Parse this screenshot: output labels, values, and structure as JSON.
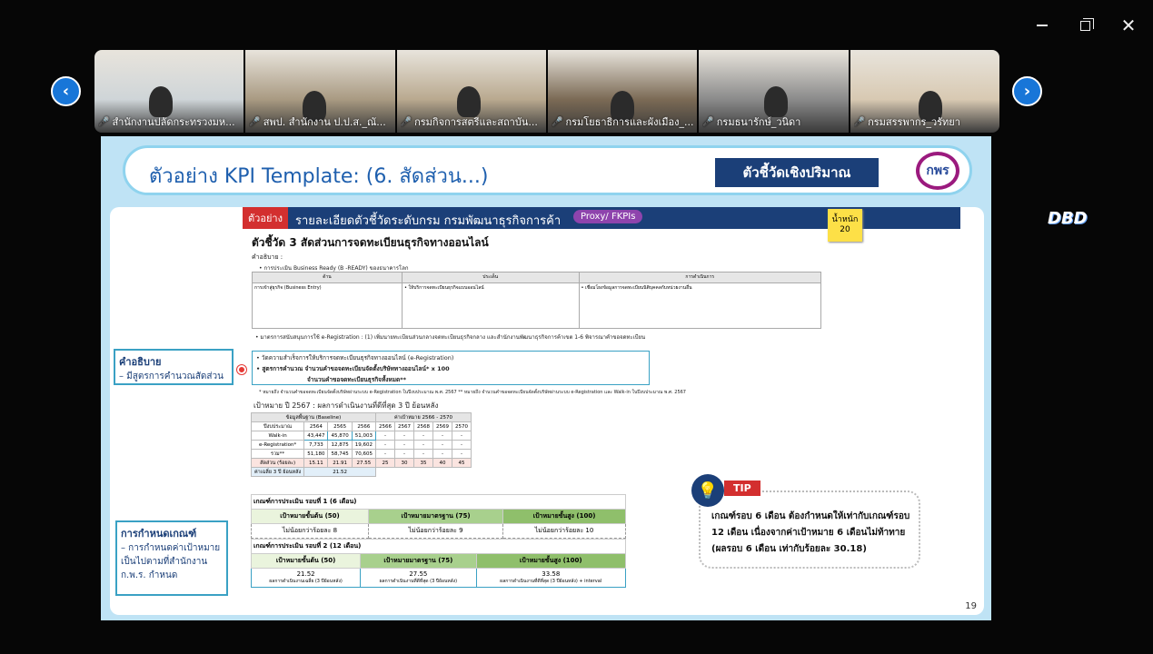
{
  "window": {
    "controls": [
      "minimize",
      "restore",
      "close"
    ]
  },
  "participants": [
    {
      "name": "สำนักงานปลัดกระทรวงมห...",
      "bg": "#cfd5d8"
    },
    {
      "name": "สพป. สำนักงาน ป.ป.ส._ณั...",
      "bg": "#a99a82"
    },
    {
      "name": "กรมกิจการสตรีและสถาบัน...",
      "bg": "#b9a98f"
    },
    {
      "name": "กรมโยธาธิการและผังเมือง_...",
      "bg": "#7b6a55"
    },
    {
      "name": "กรมธนารักษ์_วนิดา",
      "bg": "#8a8a8a"
    },
    {
      "name": "กรมสรรพากร_วรัทยา",
      "bg": "#d8c9b2"
    }
  ],
  "slide": {
    "title": "ตัวอย่าง KPI Template: (6. สัดส่วน...)",
    "badge": "ตัวชี้วัดเชิงปริมาณ",
    "logo": "กพร",
    "page": "19",
    "header": {
      "tag": "ตัวอย่าง",
      "title": "รายละเอียดตัวชี้วัดระดับกรม กรมพัฒนาธุรกิจการค้า",
      "proxy": "Proxy/ FKPIs",
      "logo": "DBD"
    },
    "weight": {
      "label": "น้ำหนัก",
      "value": "20"
    },
    "kpi_title": "ตัวชี้วัด 3 สัดส่วนการจดทะเบียนธุรกิจทางออนไลน์",
    "desc_label": "คำอธิบาย :",
    "desc_sub": "• การประเมิน Business Ready (B -READY) ของธนาคารโลก",
    "def_table": {
      "headers": [
        "ด้าน",
        "ประเด็น",
        "การดำเนินการ"
      ],
      "row": [
        "การเข้าสู่ธุรกิจ (Business Entry)",
        "• ให้บริการจดทะเบียนธุรกิจแบบออนไลน์",
        "• เชื่อมโยงข้อมูลการจดทะเบียนนิติบุคคลกับหน่วยงานอื่น"
      ]
    },
    "measure_text": "• มาตรการสนับสนุนการใช้ e-Registration : (1) เพิ่มนายทะเบียนส่วนกลางจดทะเบียนธุรกิจกลาง และสำนักงานพัฒนาธุรกิจการค้าเขต 1-6 พิจารณาคำขอจดทะเบียน",
    "formula": {
      "l1": "• วัดความสำเร็จการให้บริการจดทะเบียนธุรกิจทางออนไลน์ (e-Registration)",
      "l2": "• สูตรการคำนวณ  จำนวนคำขอจดทะเบียนจัดตั้งบริษัททางออนไลน์* x 100",
      "l3": "จำนวนคำขอจดทะเบียนธุรกิจทั้งหมด**"
    },
    "note": "* หมายถึง จำนวนคำขอจดทะเบียนจัดตั้งบริษัทผ่านระบบ e-Registration ในปีงบประมาณ พ.ศ. 2567   ** หมายถึง จำนวนคำขอจดทะเบียนจัดตั้งบริษัทผ่านระบบ e-Registration และ Walk-in ในปีงบประมาณ พ.ศ. 2567",
    "target_title": "เป้าหมาย ปี 2567 : ผลการดำเนินงานที่ดีที่สุด 3 ปี ย้อนหลัง",
    "baseline": {
      "h_base": "ข้อมูลพื้นฐาน (Baseline)",
      "h_target": "ค่าเป้าหมาย 2566 - 2570",
      "year_label": "ปีงบประมาณ",
      "years": [
        "2564",
        "2565",
        "2566",
        "2566",
        "2567",
        "2568",
        "2569",
        "2570"
      ],
      "rows": [
        {
          "label": "Walk-in",
          "vals": [
            "43,447",
            "45,870",
            "51,003",
            "-",
            "-",
            "-",
            "-",
            "-"
          ]
        },
        {
          "label": "e-Registration*",
          "vals": [
            "7,733",
            "12,875",
            "19,602",
            "-",
            "-",
            "-",
            "-",
            "-"
          ]
        },
        {
          "label": "รวม**",
          "vals": [
            "51,180",
            "58,745",
            "70,605",
            "-",
            "-",
            "-",
            "-",
            "-"
          ]
        },
        {
          "label": "สัดส่วน (ร้อยละ)",
          "vals": [
            "15.11",
            "21.91",
            "27.55",
            "25",
            "30",
            "35",
            "40",
            "45"
          ]
        },
        {
          "label": "ค่าเฉลี่ย 3 ปี ย้อนหลัง",
          "vals": [
            "21.52"
          ]
        }
      ]
    },
    "crit1": {
      "title": "เกณฑ์การประเมิน รอบที่ 1 (6 เดือน)",
      "h": [
        "เป้าหมายขั้นต้น (50)",
        "เป้าหมายมาตรฐาน (75)",
        "เป้าหมายขั้นสูง (100)"
      ],
      "v": [
        "ไม่น้อยกว่าร้อยละ 8",
        "ไม่น้อยกว่าร้อยละ 9",
        "ไม่น้อยกว่าร้อยละ 10"
      ]
    },
    "crit2": {
      "title": "เกณฑ์การประเมิน รอบที่ 2 (12 เดือน)",
      "h": [
        "เป้าหมายขั้นต้น (50)",
        "เป้าหมายมาตรฐาน (75)",
        "เป้าหมายขั้นสูง (100)"
      ],
      "v": [
        "21.52",
        "27.55",
        "33.58"
      ],
      "s": [
        "ผลการดำเนินงานเฉลี่ย (3 ปีย้อนหลัง)",
        "ผลการดำเนินงานที่ดีที่สุด (3 ปีย้อนหลัง)",
        "ผลการดำเนินงานที่ดีที่สุด (3 ปีย้อนหลัง) + interval"
      ]
    },
    "box_desc": {
      "title": "คำอธิบาย",
      "text": "– มีสูตรการคำนวณสัดส่วน"
    },
    "box_crit": {
      "title": "การกำหนดเกณฑ์",
      "text": "– การกำหนดค่าเป้าหมาย เป็นไปตามที่สำนักงาน ก.พ.ร. กำหนด"
    },
    "tip": {
      "tag": "TIP",
      "text": "เกณฑ์รอบ 6 เดือน ต้องกำหนดให้เท่ากับเกณฑ์รอบ 12 เดือน เนื่องจากค่าเป้าหมาย 6 เดือนไม่ท้าทาย (ผลรอบ 6 เดือน เท่ากับร้อยละ 30.18)"
    }
  }
}
